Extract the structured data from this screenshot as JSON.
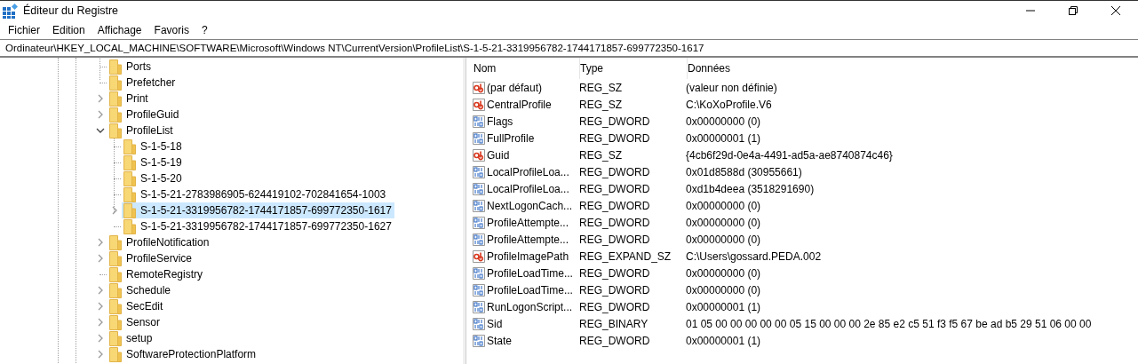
{
  "window": {
    "title": "Éditeur du Registre"
  },
  "menu": [
    "Fichier",
    "Edition",
    "Affichage",
    "Favoris",
    "?"
  ],
  "address": "Ordinateur\\HKEY_LOCAL_MACHINE\\SOFTWARE\\Microsoft\\Windows NT\\CurrentVersion\\ProfileList\\S-1-5-21-3319956782-1744171857-699772350-1617",
  "tree": [
    {
      "label": "Ports",
      "expandable": false,
      "selected": false
    },
    {
      "label": "Prefetcher",
      "expandable": false,
      "selected": false
    },
    {
      "label": "Print",
      "expandable": true,
      "expanded": false,
      "selected": false
    },
    {
      "label": "ProfileGuid",
      "expandable": true,
      "expanded": false,
      "selected": false
    },
    {
      "label": "ProfileList",
      "expandable": true,
      "expanded": true,
      "selected": false,
      "children": [
        {
          "label": "S-1-5-18",
          "expandable": false,
          "selected": false
        },
        {
          "label": "S-1-5-19",
          "expandable": false,
          "selected": false
        },
        {
          "label": "S-1-5-20",
          "expandable": false,
          "selected": false
        },
        {
          "label": "S-1-5-21-2783986905-624419102-702841654-1003",
          "expandable": false,
          "selected": false
        },
        {
          "label": "S-1-5-21-3319956782-1744171857-699772350-1617",
          "expandable": true,
          "expanded": false,
          "selected": true
        },
        {
          "label": "S-1-5-21-3319956782-1744171857-699772350-1627",
          "expandable": false,
          "selected": false
        }
      ]
    },
    {
      "label": "ProfileNotification",
      "expandable": true,
      "expanded": false,
      "selected": false
    },
    {
      "label": "ProfileService",
      "expandable": true,
      "expanded": false,
      "selected": false
    },
    {
      "label": "RemoteRegistry",
      "expandable": false,
      "selected": false
    },
    {
      "label": "Schedule",
      "expandable": true,
      "expanded": false,
      "selected": false
    },
    {
      "label": "SecEdit",
      "expandable": true,
      "expanded": false,
      "selected": false
    },
    {
      "label": "Sensor",
      "expandable": true,
      "expanded": false,
      "selected": false
    },
    {
      "label": "setup",
      "expandable": true,
      "expanded": false,
      "selected": false
    },
    {
      "label": "SoftwareProtectionPlatform",
      "expandable": true,
      "expanded": false,
      "selected": false
    }
  ],
  "values": {
    "columns": [
      "Nom",
      "Type",
      "Données"
    ],
    "rows": [
      {
        "kind": "string",
        "name": "(par défaut)",
        "type": "REG_SZ",
        "data": "(valeur non définie)"
      },
      {
        "kind": "string",
        "name": "CentralProfile",
        "type": "REG_SZ",
        "data": "C:\\KoXoProfile.V6"
      },
      {
        "kind": "binary",
        "name": "Flags",
        "type": "REG_DWORD",
        "data": "0x00000000 (0)"
      },
      {
        "kind": "binary",
        "name": "FullProfile",
        "type": "REG_DWORD",
        "data": "0x00000001 (1)"
      },
      {
        "kind": "string",
        "name": "Guid",
        "type": "REG_SZ",
        "data": "{4cb6f29d-0e4a-4491-ad5a-ae8740874c46}"
      },
      {
        "kind": "binary",
        "name": "LocalProfileLoa...",
        "type": "REG_DWORD",
        "data": "0x01d8588d (30955661)"
      },
      {
        "kind": "binary",
        "name": "LocalProfileLoa...",
        "type": "REG_DWORD",
        "data": "0xd1b4deea (3518291690)"
      },
      {
        "kind": "binary",
        "name": "NextLogonCach...",
        "type": "REG_DWORD",
        "data": "0x00000000 (0)"
      },
      {
        "kind": "binary",
        "name": "ProfileAttempte...",
        "type": "REG_DWORD",
        "data": "0x00000000 (0)"
      },
      {
        "kind": "binary",
        "name": "ProfileAttempte...",
        "type": "REG_DWORD",
        "data": "0x00000000 (0)"
      },
      {
        "kind": "string",
        "name": "ProfileImagePath",
        "type": "REG_EXPAND_SZ",
        "data": "C:\\Users\\gossard.PEDA.002"
      },
      {
        "kind": "binary",
        "name": "ProfileLoadTime...",
        "type": "REG_DWORD",
        "data": "0x00000000 (0)"
      },
      {
        "kind": "binary",
        "name": "ProfileLoadTime...",
        "type": "REG_DWORD",
        "data": "0x00000000 (0)"
      },
      {
        "kind": "binary",
        "name": "RunLogonScript...",
        "type": "REG_DWORD",
        "data": "0x00000001 (1)"
      },
      {
        "kind": "binary",
        "name": "Sid",
        "type": "REG_BINARY",
        "data": "01 05 00 00 00 00 00 05 15 00 00 00 2e 85 e2 c5 51 f3 f5 67 be ad b5 29 51 06 00 00"
      },
      {
        "kind": "binary",
        "name": "State",
        "type": "REG_DWORD",
        "data": "0x00000001 (1)"
      }
    ]
  }
}
